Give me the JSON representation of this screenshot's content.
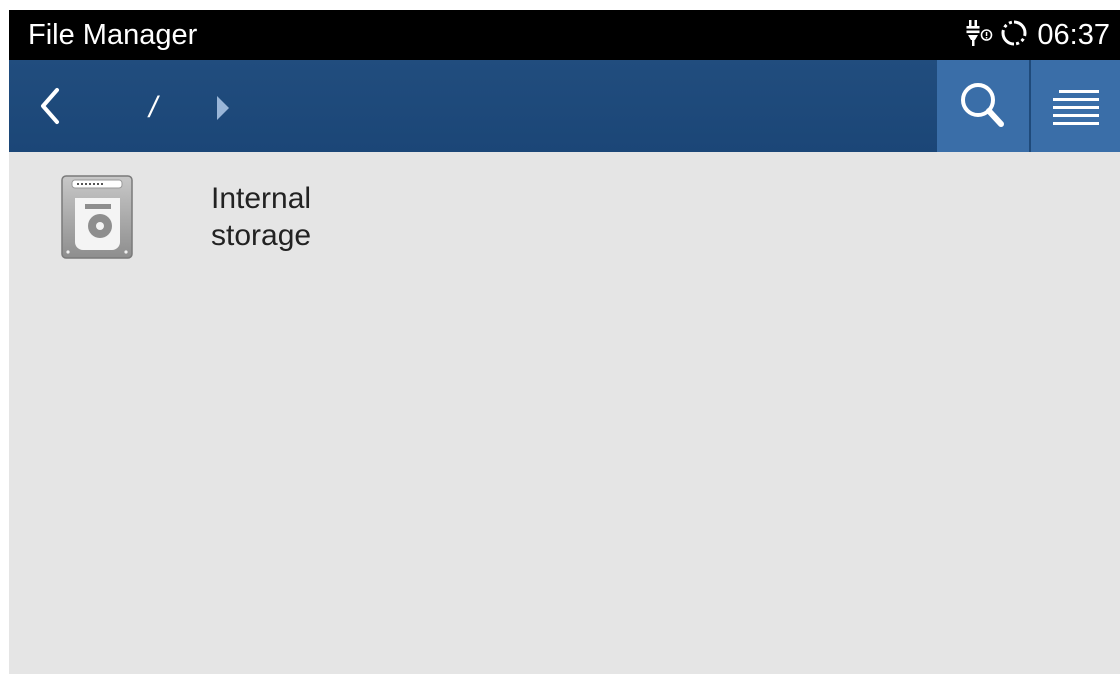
{
  "status_bar": {
    "app_title": "File Manager",
    "icons": [
      "usb-debug-icon",
      "sync-icon"
    ],
    "time": "06:37"
  },
  "toolbar": {
    "path": "/",
    "back_icon": "chevron-left-icon",
    "path_arrow_icon": "triangle-right-icon",
    "search_icon": "search-icon",
    "menu_icon": "list-menu-icon"
  },
  "files": [
    {
      "icon": "hard-drive-icon",
      "label": "Internal\nstorage"
    }
  ],
  "colors": {
    "status_bar": "#000000",
    "toolbar": "#1e4a7b",
    "toolbar_button": "#3a6ea8",
    "background": "#e5e5e5",
    "text": "#222222"
  }
}
